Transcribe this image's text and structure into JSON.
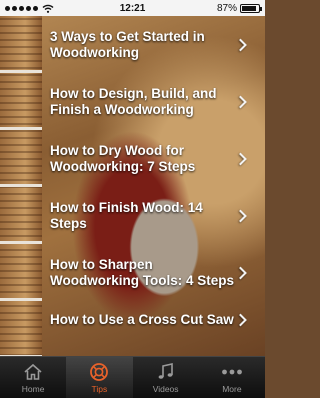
{
  "status_bar": {
    "time": "12:21",
    "battery_text": "87%",
    "battery_level": 0.87
  },
  "articles": [
    {
      "title": "3 Ways to Get Started in Woodworking"
    },
    {
      "title": "How to Design, Build, and Finish a Woodworking"
    },
    {
      "title": "How to Dry Wood for Woodworking: 7 Steps"
    },
    {
      "title": "How to Finish Wood: 14 Steps"
    },
    {
      "title": "How to Sharpen Woodworking Tools: 4 Steps"
    },
    {
      "title": "How to Use a Cross Cut Saw"
    }
  ],
  "tab_bar": {
    "tabs": [
      {
        "label": "Home",
        "icon": "home-icon"
      },
      {
        "label": "Tips",
        "icon": "lifebuoy-icon",
        "active": true
      },
      {
        "label": "Videos",
        "icon": "music-notes-icon"
      },
      {
        "label": "More",
        "icon": "more-dots-icon"
      }
    ]
  },
  "colors": {
    "tab_active_accent": "#e8622a",
    "tab_inactive": "#9a9a9a",
    "item_text": "#ffffff"
  }
}
